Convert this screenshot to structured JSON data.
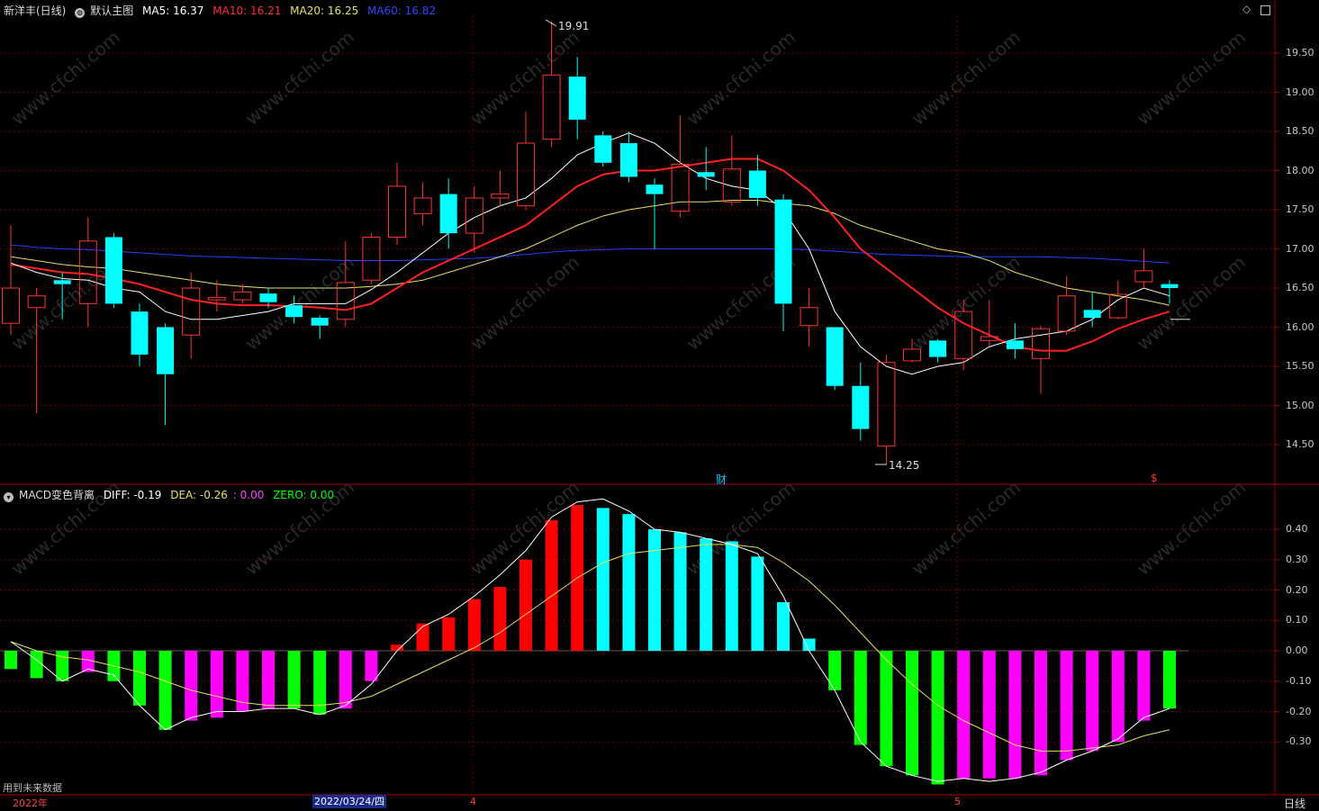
{
  "header": {
    "stock_name": "新洋丰(日线)",
    "main_chart_name": "默认主图",
    "ma5": "MA5: 16.37",
    "ma10": "MA10: 16.21",
    "ma20": "MA20: 16.25",
    "ma60": "MA60: 16.82"
  },
  "macd_header": {
    "indicator_name": "MACD变色背离",
    "diff": "DIFF: -0.19",
    "dea": "DEA: -0.26",
    "extra": ": 0.00",
    "zero": "ZERO: 0.00"
  },
  "annotations": {
    "high_label": "19.91",
    "low_label": "14.25",
    "fin_marker": "财",
    "dollar_marker": "$",
    "future_data": "用到未来数据"
  },
  "time_axis": {
    "year": "2022年",
    "selected_date": "2022/03/24/四",
    "month_4": "4",
    "month_5": "5",
    "period": "日线"
  },
  "price_axis": [
    "19.50",
    "19.00",
    "18.50",
    "18.00",
    "17.50",
    "17.00",
    "16.50",
    "16.00",
    "15.50",
    "15.00",
    "14.50"
  ],
  "macd_axis": [
    "0.40",
    "0.30",
    "0.20",
    "0.10",
    "0.00",
    "-0.10",
    "-0.20",
    "-0.30"
  ],
  "watermark": "www.cfchi.com",
  "colors": {
    "up": "#ff3232",
    "down": "#00ffff",
    "ma5": "#ffffff",
    "ma10": "#ff2020",
    "ma20": "#e8e060",
    "ma60": "#2040ff",
    "macd_green": "#00ff00",
    "macd_magenta": "#ff00ff",
    "macd_red": "#ff0000",
    "macd_cyan": "#00ffff"
  },
  "chart_data": {
    "type": "candlestick",
    "price_ylim": [
      14.0,
      20.0
    ],
    "macd_ylim": [
      -0.45,
      0.5
    ],
    "candles": [
      {
        "o": 16.05,
        "c": 16.5,
        "h": 17.3,
        "l": 15.9
      },
      {
        "o": 16.25,
        "c": 16.4,
        "h": 16.5,
        "l": 14.9
      },
      {
        "o": 16.6,
        "c": 16.55,
        "h": 16.7,
        "l": 16.1
      },
      {
        "o": 16.3,
        "c": 17.1,
        "h": 17.4,
        "l": 16.0
      },
      {
        "o": 17.15,
        "c": 16.3,
        "h": 17.2,
        "l": 16.25
      },
      {
        "o": 16.2,
        "c": 15.65,
        "h": 16.3,
        "l": 15.5
      },
      {
        "o": 16.0,
        "c": 15.4,
        "h": 16.05,
        "l": 14.75
      },
      {
        "o": 15.9,
        "c": 16.5,
        "h": 16.7,
        "l": 15.6
      },
      {
        "o": 16.35,
        "c": 16.38,
        "h": 16.6,
        "l": 16.2
      },
      {
        "o": 16.35,
        "c": 16.45,
        "h": 16.55,
        "l": 16.3
      },
      {
        "o": 16.43,
        "c": 16.32,
        "h": 16.5,
        "l": 16.25
      },
      {
        "o": 16.28,
        "c": 16.13,
        "h": 16.4,
        "l": 16.05
      },
      {
        "o": 16.12,
        "c": 16.02,
        "h": 16.15,
        "l": 15.85
      },
      {
        "o": 16.1,
        "c": 16.57,
        "h": 17.1,
        "l": 16.0
      },
      {
        "o": 16.6,
        "c": 17.15,
        "h": 17.2,
        "l": 16.55
      },
      {
        "o": 17.15,
        "c": 17.8,
        "h": 18.1,
        "l": 17.05
      },
      {
        "o": 17.45,
        "c": 17.65,
        "h": 17.85,
        "l": 17.3
      },
      {
        "o": 17.7,
        "c": 17.2,
        "h": 17.9,
        "l": 17.0
      },
      {
        "o": 17.2,
        "c": 17.65,
        "h": 17.8,
        "l": 16.95
      },
      {
        "o": 17.65,
        "c": 17.7,
        "h": 18.0,
        "l": 17.55
      },
      {
        "o": 17.55,
        "c": 18.35,
        "h": 18.75,
        "l": 17.5
      },
      {
        "o": 18.4,
        "c": 19.22,
        "h": 19.91,
        "l": 18.3
      },
      {
        "o": 19.2,
        "c": 18.65,
        "h": 19.45,
        "l": 18.4
      },
      {
        "o": 18.45,
        "c": 18.1,
        "h": 18.5,
        "l": 18.05
      },
      {
        "o": 18.35,
        "c": 17.92,
        "h": 18.5,
        "l": 17.85
      },
      {
        "o": 17.82,
        "c": 17.7,
        "h": 17.9,
        "l": 17.0
      },
      {
        "o": 17.48,
        "c": 18.08,
        "h": 18.7,
        "l": 17.4
      },
      {
        "o": 17.98,
        "c": 17.92,
        "h": 18.3,
        "l": 17.75
      },
      {
        "o": 17.6,
        "c": 18.02,
        "h": 18.45,
        "l": 17.55
      },
      {
        "o": 18.0,
        "c": 17.65,
        "h": 18.2,
        "l": 17.55
      },
      {
        "o": 17.63,
        "c": 16.3,
        "h": 17.7,
        "l": 15.95
      },
      {
        "o": 16.02,
        "c": 16.25,
        "h": 16.5,
        "l": 15.75
      },
      {
        "o": 16.0,
        "c": 15.25,
        "h": 16.0,
        "l": 15.2
      },
      {
        "o": 15.25,
        "c": 14.7,
        "h": 15.55,
        "l": 14.55
      },
      {
        "o": 14.48,
        "c": 15.55,
        "h": 15.65,
        "l": 14.25
      },
      {
        "o": 15.57,
        "c": 15.72,
        "h": 15.85,
        "l": 15.55
      },
      {
        "o": 15.83,
        "c": 15.62,
        "h": 15.85,
        "l": 15.55
      },
      {
        "o": 15.6,
        "c": 16.2,
        "h": 16.35,
        "l": 15.45
      },
      {
        "o": 15.83,
        "c": 15.88,
        "h": 16.35,
        "l": 15.75
      },
      {
        "o": 15.83,
        "c": 15.72,
        "h": 16.05,
        "l": 15.6
      },
      {
        "o": 15.6,
        "c": 15.98,
        "h": 16.02,
        "l": 15.15
      },
      {
        "o": 15.95,
        "c": 16.4,
        "h": 16.65,
        "l": 15.9
      },
      {
        "o": 16.22,
        "c": 16.12,
        "h": 16.45,
        "l": 16.0
      },
      {
        "o": 16.12,
        "c": 16.42,
        "h": 16.6,
        "l": 16.1
      },
      {
        "o": 16.58,
        "c": 16.72,
        "h": 17.0,
        "l": 16.5
      },
      {
        "o": 16.55,
        "c": 16.5,
        "h": 16.6,
        "l": 16.3
      }
    ],
    "ma5": [
      16.82,
      16.7,
      16.62,
      16.6,
      16.5,
      16.45,
      16.2,
      16.1,
      16.1,
      16.15,
      16.2,
      16.3,
      16.3,
      16.3,
      16.48,
      16.7,
      16.95,
      17.2,
      17.4,
      17.55,
      17.65,
      17.9,
      18.2,
      18.35,
      18.48,
      18.35,
      18.1,
      17.9,
      17.8,
      17.75,
      17.5,
      17.0,
      16.2,
      15.75,
      15.5,
      15.4,
      15.5,
      15.55,
      15.75,
      15.85,
      15.9,
      15.95,
      16.1,
      16.35,
      16.5,
      16.4
    ],
    "ma10": [
      16.8,
      16.75,
      16.7,
      16.68,
      16.62,
      16.55,
      16.45,
      16.35,
      16.3,
      16.28,
      16.28,
      16.27,
      16.25,
      16.22,
      16.3,
      16.5,
      16.7,
      16.85,
      17.0,
      17.15,
      17.3,
      17.55,
      17.8,
      17.95,
      18.0,
      18.0,
      18.05,
      18.1,
      18.15,
      18.15,
      18.0,
      17.75,
      17.4,
      17.0,
      16.75,
      16.5,
      16.25,
      16.05,
      15.9,
      15.75,
      15.7,
      15.7,
      15.82,
      15.98,
      16.1,
      16.2
    ],
    "ma20": [
      16.9,
      16.85,
      16.8,
      16.77,
      16.75,
      16.7,
      16.65,
      16.6,
      16.55,
      16.52,
      16.5,
      16.5,
      16.5,
      16.5,
      16.52,
      16.55,
      16.6,
      16.7,
      16.8,
      16.9,
      17.0,
      17.15,
      17.3,
      17.42,
      17.5,
      17.55,
      17.6,
      17.6,
      17.62,
      17.62,
      17.58,
      17.55,
      17.45,
      17.3,
      17.2,
      17.1,
      17.0,
      16.95,
      16.85,
      16.7,
      16.6,
      16.5,
      16.45,
      16.4,
      16.35,
      16.28
    ],
    "ma60": [
      17.05,
      17.02,
      17.0,
      16.99,
      16.97,
      16.95,
      16.93,
      16.91,
      16.9,
      16.89,
      16.88,
      16.87,
      16.86,
      16.85,
      16.85,
      16.85,
      16.86,
      16.87,
      16.88,
      16.9,
      16.93,
      16.96,
      16.98,
      16.99,
      17.0,
      17.0,
      17.0,
      17.0,
      17.0,
      17.0,
      17.0,
      16.99,
      16.97,
      16.95,
      16.93,
      16.92,
      16.91,
      16.9,
      16.9,
      16.9,
      16.9,
      16.89,
      16.88,
      16.86,
      16.84,
      16.82
    ],
    "macd_hist": [
      -0.06,
      -0.09,
      -0.1,
      -0.07,
      -0.1,
      -0.18,
      -0.26,
      -0.23,
      -0.22,
      -0.2,
      -0.19,
      -0.19,
      -0.21,
      -0.19,
      -0.1,
      0.02,
      0.09,
      0.11,
      0.17,
      0.21,
      0.3,
      0.43,
      0.48,
      0.47,
      0.45,
      0.4,
      0.39,
      0.37,
      0.36,
      0.31,
      0.16,
      0.04,
      -0.13,
      -0.31,
      -0.38,
      -0.41,
      -0.44,
      -0.42,
      -0.42,
      -0.42,
      -0.41,
      -0.36,
      -0.33,
      -0.3,
      -0.23,
      -0.19
    ],
    "macd_colors": [
      "g",
      "g",
      "g",
      "m",
      "g",
      "g",
      "g",
      "m",
      "m",
      "m",
      "m",
      "g",
      "g",
      "m",
      "m",
      "r",
      "r",
      "r",
      "r",
      "r",
      "r",
      "r",
      "r",
      "c",
      "c",
      "c",
      "c",
      "c",
      "c",
      "c",
      "c",
      "c",
      "g",
      "g",
      "g",
      "g",
      "g",
      "m",
      "m",
      "m",
      "m",
      "m",
      "m",
      "m",
      "m",
      "g"
    ],
    "diff": [
      0.03,
      -0.03,
      -0.1,
      -0.06,
      -0.08,
      -0.18,
      -0.26,
      -0.22,
      -0.2,
      -0.2,
      -0.19,
      -0.19,
      -0.21,
      -0.18,
      -0.11,
      0.0,
      0.08,
      0.12,
      0.18,
      0.25,
      0.33,
      0.44,
      0.49,
      0.5,
      0.46,
      0.4,
      0.39,
      0.37,
      0.35,
      0.32,
      0.18,
      0.0,
      -0.13,
      -0.3,
      -0.38,
      -0.41,
      -0.43,
      -0.42,
      -0.43,
      -0.42,
      -0.4,
      -0.36,
      -0.33,
      -0.29,
      -0.22,
      -0.19
    ],
    "dea": [
      0.03,
      0.0,
      -0.02,
      -0.03,
      -0.05,
      -0.07,
      -0.1,
      -0.13,
      -0.15,
      -0.17,
      -0.18,
      -0.18,
      -0.18,
      -0.17,
      -0.15,
      -0.11,
      -0.07,
      -0.03,
      0.01,
      0.06,
      0.12,
      0.18,
      0.24,
      0.29,
      0.32,
      0.33,
      0.34,
      0.35,
      0.35,
      0.34,
      0.29,
      0.23,
      0.15,
      0.06,
      -0.03,
      -0.11,
      -0.18,
      -0.23,
      -0.27,
      -0.31,
      -0.33,
      -0.33,
      -0.32,
      -0.31,
      -0.28,
      -0.26
    ]
  }
}
